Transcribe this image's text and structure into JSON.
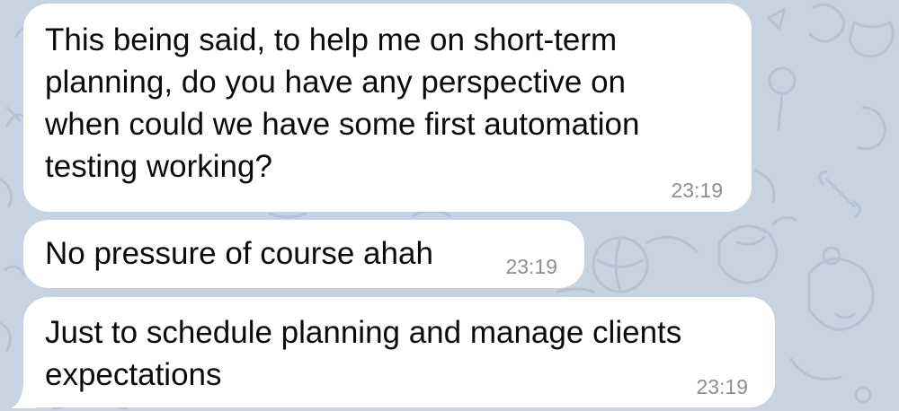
{
  "chat": {
    "background_color": "#c7d3e1",
    "bubble_color": "#ffffff",
    "messages": [
      {
        "text": "This being said, to help me on short-term\nplanning, do you have any perspective on\nwhen could we have some first automation\ntesting working?",
        "time": "23:19"
      },
      {
        "text": "No pressure of course ahah",
        "time": "23:19"
      },
      {
        "text": "Just to schedule planning and manage clients\nexpectations",
        "time": "23:19"
      }
    ]
  }
}
